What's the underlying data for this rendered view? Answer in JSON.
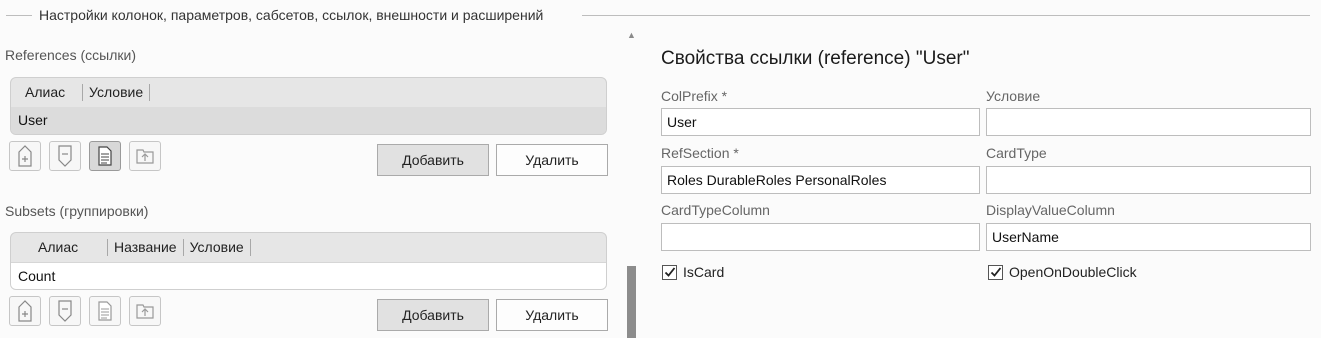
{
  "group": {
    "title": "Настройки колонок, параметров, сабсетов, ссылок, внешности и расширений"
  },
  "references": {
    "label": "References (ссылки)",
    "columns": [
      "Алиас",
      "Условие"
    ],
    "rows": [
      "User"
    ],
    "add_label": "Добавить",
    "delete_label": "Удалить"
  },
  "subsets": {
    "label": "Subsets (группировки)",
    "columns": [
      "Алиас",
      "Название",
      "Условие"
    ],
    "rows": [
      "Count"
    ],
    "add_label": "Добавить",
    "delete_label": "Удалить"
  },
  "toolbar_icons": [
    "move-up-icon",
    "move-down-icon",
    "properties-icon",
    "export-icon"
  ],
  "properties": {
    "title": "Свойства ссылки (reference) \"User\"",
    "colprefix": {
      "label": "ColPrefix  *",
      "value": "User"
    },
    "condition": {
      "label": "Условие",
      "value": ""
    },
    "refsection": {
      "label": "RefSection  *",
      "value": "Roles DurableRoles PersonalRoles"
    },
    "cardtype": {
      "label": "CardType",
      "value": ""
    },
    "cardtypecolumn": {
      "label": "CardTypeColumn",
      "value": ""
    },
    "displayvaluecolumn": {
      "label": "DisplayValueColumn",
      "value": "UserName"
    },
    "iscard": {
      "label": "IsCard",
      "checked": true
    },
    "openondoubleclick": {
      "label": "OpenOnDoubleClick",
      "checked": true
    }
  },
  "colors": {
    "background": "#fbfbfb",
    "grid_header": "#e6e6e6",
    "selected_row": "#dcdcdc",
    "scroll_thumb": "#8c8c8c"
  }
}
